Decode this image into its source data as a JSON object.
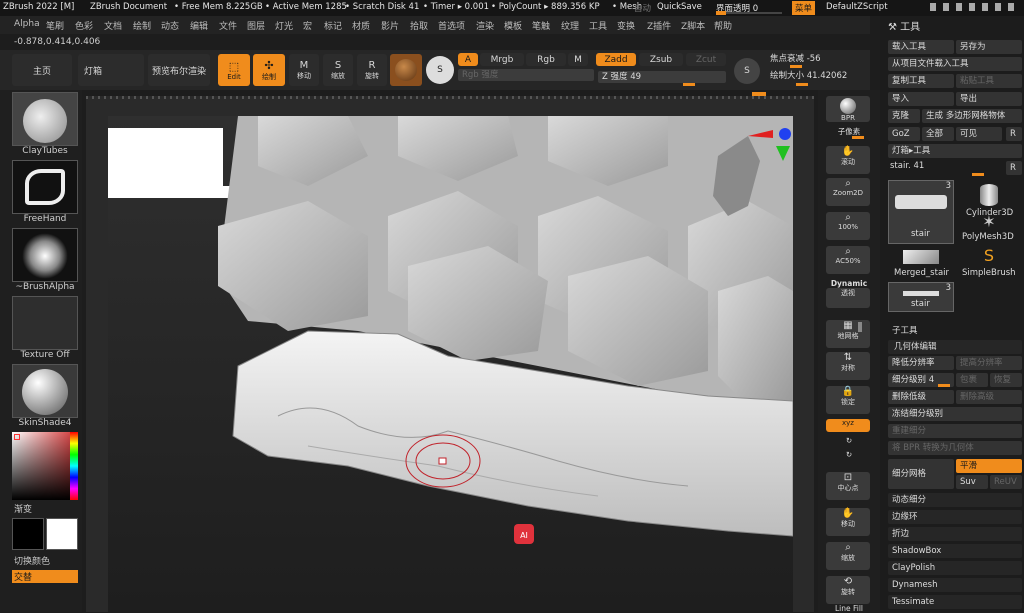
{
  "title": {
    "app": "ZBrush 2022 [M]",
    "doc": "ZBrush Document",
    "free_mem": "• Free Mem 8.225GB",
    "active_mem": "• Active Mem 1285",
    "scratch": "• Scratch Disk 41",
    "timer": "• Timer ▸ 0.001",
    "polycount": "• PolyCount ▸ 889.356 KP",
    "mesh": "• Mesh",
    "auto": "自动",
    "quicksave": "QuickSave",
    "transparency": "界面透明 0",
    "menu": "菜单",
    "script": "DefaultZScript"
  },
  "menu": [
    "Alpha",
    "笔刷",
    "色彩",
    "文档",
    "绘制",
    "动态",
    "编辑",
    "文件",
    "图层",
    "灯光",
    "宏",
    "标记",
    "材质",
    "影片",
    "拾取",
    "首选项",
    "渲染",
    "模板",
    "笔触",
    "纹理",
    "工具",
    "变换",
    "Z插件",
    "Z脚本",
    "帮助"
  ],
  "coords": "-0.878,0.414,0.406",
  "toolbar": {
    "home": "主页",
    "lightbox": "灯箱",
    "bpr_preview": "预览布尔渲染",
    "edit": "Edit",
    "draw": "绘制",
    "move": "移动",
    "scale": "缩放",
    "rotate": "旋转",
    "a": "A",
    "mrgb": "Mrgb",
    "rgb": "Rgb",
    "m": "M",
    "zadd": "Zadd",
    "zsub": "Zsub",
    "zcut": "Zcut",
    "rgb_intensity": "Rgb 强度",
    "z_intensity": "Z 强度 49",
    "focal_shift": "焦点衰减 -56",
    "draw_size": "绘制大小 41.42062"
  },
  "left_shelf": {
    "brush": "ClayTubes",
    "stroke": "FreeHand",
    "alpha": "~BrushAlpha",
    "texture": "Texture Off",
    "material": "SkinShade4",
    "gradient": "渐变",
    "switch_color": "切换颜色",
    "alternate": "交替"
  },
  "right_shelf": {
    "bpr": "BPR",
    "subpixel": "子像素",
    "scroll": "滚动",
    "zoom2d": "Zoom2D",
    "100": "100%",
    "ac50": "AC50%",
    "dynamic": "Dynamic",
    "persp": "透视",
    "floor": "地网格",
    "local": "对称",
    "lock": "锁定",
    "xyz": "xyz",
    "center": "中心点",
    "move": "移动",
    "zoom": "缩放",
    "rotate": "旋转",
    "linefill": "Line Fill"
  },
  "panel": {
    "header": "工具",
    "load_tool": "载入工具",
    "save_as": "另存为",
    "load_from_project": "从项目文件载入工具",
    "copy_tool": "复制工具",
    "paste_tool": "粘贴工具",
    "import": "导入",
    "export": "导出",
    "clone": "克隆",
    "make_polymesh": "生成 多边形网格物体",
    "goz": "GoZ",
    "all": "全部",
    "visible": "可见",
    "r": "R",
    "lightbox_tools": "灯箱▸工具",
    "current_tool": "stair. 41",
    "thumb_count": "3",
    "thumbs": [
      "stair",
      "Cylinder3D",
      "PolyMesh3D",
      "Merged_stair",
      "SimpleBrush",
      "stair"
    ],
    "subtool": "子工具",
    "geometry": "几何体编辑",
    "lower_res": "降低分辨率",
    "higher_res": "提高分辨率",
    "sdiv": "细分级别 4",
    "cage": "包裹",
    "rstr": "恢复",
    "del_lower": "删除低级",
    "del_higher": "删除高级",
    "freeze": "冻结细分级别",
    "reconstruct": "重建细分",
    "convert_bpr": "将 BPR 转换为几何体",
    "divide": "细分网格",
    "smooth": "平滑",
    "suv": "Suv",
    "reuv": "ReUV",
    "dynamic_sub": "动态细分",
    "edgeloop": "边缘环",
    "crease": "折边",
    "shadowbox": "ShadowBox",
    "claypolish": "ClayPolish",
    "dynamesh": "Dynamesh",
    "tessimate": "Tessimate"
  },
  "colors": {
    "accent": "#f08c1c",
    "bg": "#1d1d1d"
  }
}
